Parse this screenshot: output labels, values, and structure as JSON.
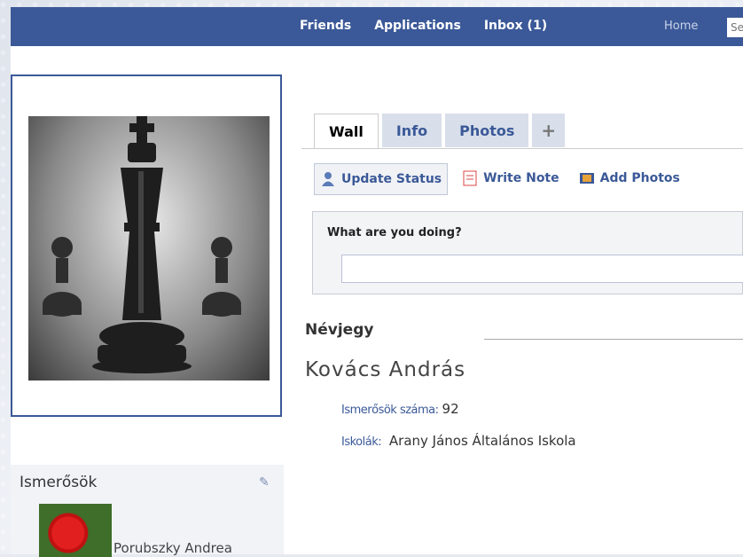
{
  "topbar": {
    "nav": [
      "Friends",
      "Applications",
      "Inbox (1)"
    ],
    "home": "Home",
    "search_placeholder": "Se"
  },
  "tabs": [
    "Wall",
    "Info",
    "Photos",
    "+"
  ],
  "actions": [
    {
      "label": "Update Status",
      "icon": "person-icon"
    },
    {
      "label": "Write Note",
      "icon": "note-icon"
    },
    {
      "label": "Add Photos",
      "icon": "photo-icon"
    }
  ],
  "status": {
    "question": "What are you doing?"
  },
  "about": {
    "heading": "Névjegy",
    "name": "Kovács András",
    "friends_label": "Ismerősök száma:",
    "friends_count": "92",
    "school_label": "Iskolák:",
    "school": "Arany János Általános Iskola"
  },
  "friends_box": {
    "title": "Ismerősök",
    "friend_name": "Porubszky Andrea"
  },
  "colors": {
    "brand": "#3b5998",
    "tab_bg": "#d8dfea"
  }
}
